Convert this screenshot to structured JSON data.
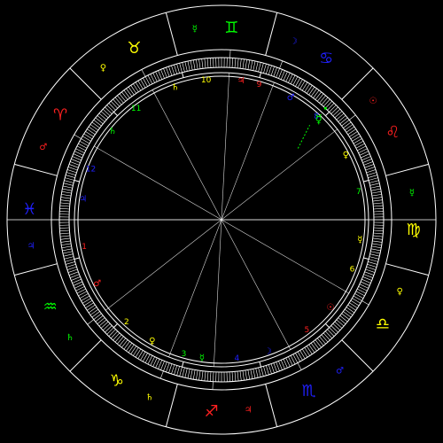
{
  "colors": {
    "background": "#000000",
    "lines": "#ffffff",
    "fire": "#ff2020",
    "earth": "#ffff00",
    "air": "#00ff00",
    "water": "#2020ff"
  },
  "signs": [
    {
      "name": "aries",
      "symbol": "♈",
      "color": "#ff2020"
    },
    {
      "name": "taurus",
      "symbol": "♉",
      "color": "#ffff00"
    },
    {
      "name": "gemini",
      "symbol": "♊",
      "color": "#00ff00"
    },
    {
      "name": "cancer",
      "symbol": "♋",
      "color": "#2020ff"
    },
    {
      "name": "leo",
      "symbol": "♌",
      "color": "#ff2020"
    },
    {
      "name": "virgo",
      "symbol": "♍",
      "color": "#ffff00"
    },
    {
      "name": "libra",
      "symbol": "♎",
      "color": "#ffff00"
    },
    {
      "name": "scorpio",
      "symbol": "♏",
      "color": "#2020ff"
    },
    {
      "name": "sagittarius",
      "symbol": "♐",
      "color": "#ff2020"
    },
    {
      "name": "capricorn",
      "symbol": "♑",
      "color": "#ffff00"
    },
    {
      "name": "aquarius",
      "symbol": "♒",
      "color": "#00ff00"
    },
    {
      "name": "pisces",
      "symbol": "♓",
      "color": "#2020ff"
    }
  ],
  "rulers": [
    {
      "sign": "aries",
      "symbol": "♂",
      "color": "#ff2020"
    },
    {
      "sign": "taurus",
      "symbol": "♀",
      "color": "#ffff00"
    },
    {
      "sign": "gemini",
      "symbol": "☿",
      "color": "#00ff00"
    },
    {
      "sign": "cancer",
      "symbol": "☽",
      "color": "#2020ff"
    },
    {
      "sign": "leo",
      "symbol": "☉",
      "color": "#ff2020"
    },
    {
      "sign": "virgo",
      "symbol": "☿",
      "color": "#00ff00"
    },
    {
      "sign": "libra",
      "symbol": "♀",
      "color": "#ffff00"
    },
    {
      "sign": "scorpio",
      "symbol": "♂",
      "color": "#2020ff"
    },
    {
      "sign": "sagittarius",
      "symbol": "♃",
      "color": "#ff2020"
    },
    {
      "sign": "capricorn",
      "symbol": "♄",
      "color": "#ffff00"
    },
    {
      "sign": "aquarius",
      "symbol": "♄",
      "color": "#00ff00"
    },
    {
      "sign": "pisces",
      "symbol": "♃",
      "color": "#2020ff"
    }
  ],
  "houses": [
    {
      "number": "1",
      "color": "#ff2020",
      "ruler": "♂",
      "ruler_color": "#ff2020"
    },
    {
      "number": "2",
      "color": "#ffff00",
      "ruler": "♀",
      "ruler_color": "#ffff00"
    },
    {
      "number": "3",
      "color": "#00ff00",
      "ruler": "☿",
      "ruler_color": "#00ff00"
    },
    {
      "number": "4",
      "color": "#2020ff",
      "ruler": "☽",
      "ruler_color": "#2020ff"
    },
    {
      "number": "5",
      "color": "#ff2020",
      "ruler": "☉",
      "ruler_color": "#ff2020"
    },
    {
      "number": "6",
      "color": "#ffff00",
      "ruler": "☿",
      "ruler_color": "#ffff00"
    },
    {
      "number": "7",
      "color": "#00ff00",
      "ruler": "♀",
      "ruler_color": "#ffff00"
    },
    {
      "number": "8",
      "color": "#2020ff",
      "ruler": "♂",
      "ruler_color": "#2020ff"
    },
    {
      "number": "9",
      "color": "#ff2020",
      "ruler": "♃",
      "ruler_color": "#ff2020"
    },
    {
      "number": "10",
      "color": "#ffff00",
      "ruler": "♄",
      "ruler_color": "#ffff00"
    },
    {
      "number": "11",
      "color": "#00ff00",
      "ruler": "♄",
      "ruler_color": "#00ff00"
    },
    {
      "number": "12",
      "color": "#2020ff",
      "ruler": "♃",
      "ruler_color": "#2020ff"
    }
  ],
  "planets": [
    {
      "name": "mercury",
      "symbol": "☿",
      "color": "#00ff00"
    }
  ]
}
